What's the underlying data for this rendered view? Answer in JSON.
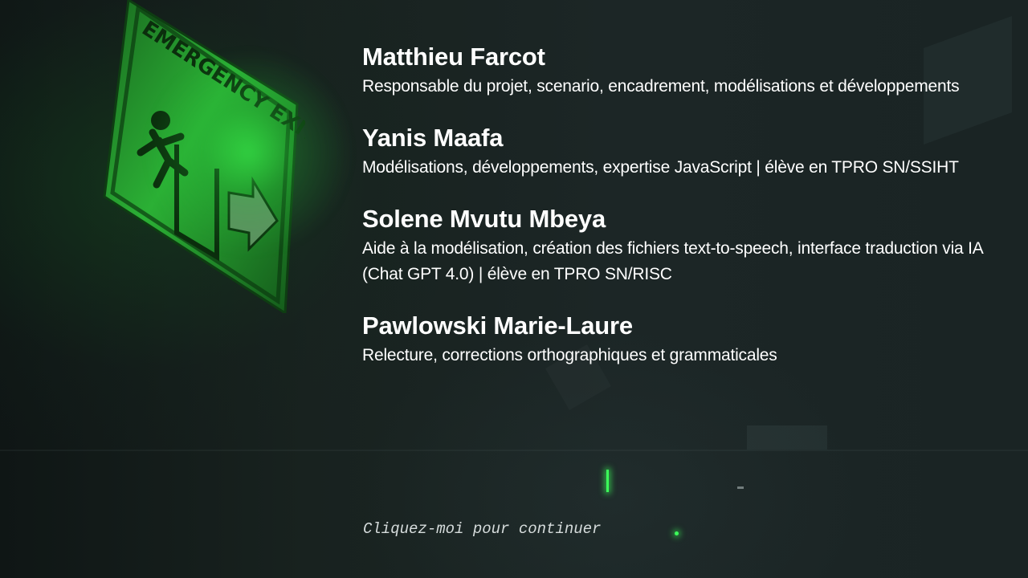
{
  "background": {
    "sign_text": "EMERGENCY EXIT",
    "sign_color": "#1f7a24",
    "glow_color": "#3cff5a"
  },
  "credits": [
    {
      "name": "Matthieu Farcot",
      "role": "Responsable du projet, scenario, encadrement, modélisations et développements"
    },
    {
      "name": "Yanis Maafa",
      "role": "Modélisations, développements, expertise JavaScript | élève en TPRO SN/SSIHT"
    },
    {
      "name": "Solene Mvutu Mbeya",
      "role": "Aide à la modélisation, création des fichiers text-to-speech, interface traduction via IA (Chat GPT 4.0) | élève en TPRO SN/RISC"
    },
    {
      "name": "Pawlowski Marie-Laure",
      "role": "Relecture, corrections orthographiques et grammaticales"
    }
  ],
  "continue_label": "Cliquez-moi pour continuer"
}
